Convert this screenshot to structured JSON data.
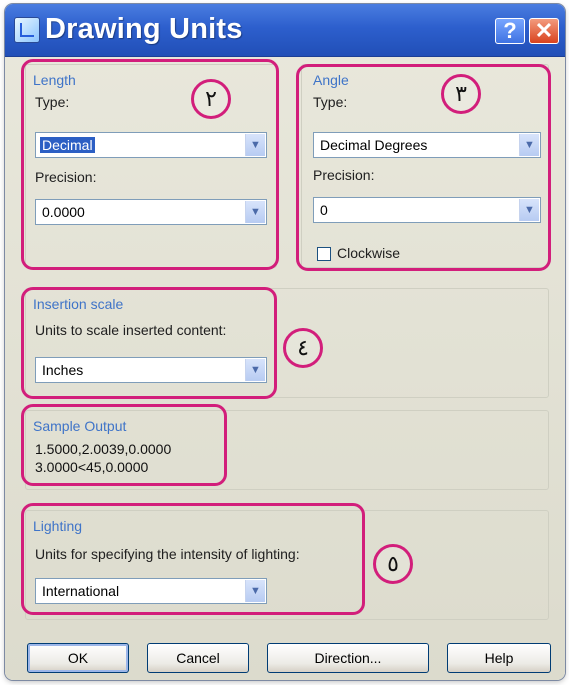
{
  "window": {
    "title": "Drawing Units",
    "help_glyph": "?",
    "close_glyph": "✕"
  },
  "length": {
    "legend": "Length",
    "type_label": "Type:",
    "type_value": "Decimal",
    "precision_label": "Precision:",
    "precision_value": "0.0000",
    "marker": "٢"
  },
  "angle": {
    "legend": "Angle",
    "type_label": "Type:",
    "type_value": "Decimal Degrees",
    "precision_label": "Precision:",
    "precision_value": "0",
    "clockwise_label": "Clockwise",
    "clockwise_checked": false,
    "marker": "٣"
  },
  "insertion": {
    "legend": "Insertion scale",
    "units_label": "Units to scale inserted content:",
    "units_value": "Inches",
    "marker": "٤"
  },
  "sample": {
    "legend": "Sample Output",
    "line1": "1.5000,2.0039,0.0000",
    "line2": "3.0000<45,0.0000"
  },
  "lighting": {
    "legend": "Lighting",
    "units_label": "Units for specifying the intensity of lighting:",
    "units_value": "International",
    "marker": "٥"
  },
  "buttons": {
    "ok": "OK",
    "cancel": "Cancel",
    "direction": "Direction...",
    "help": "Help"
  },
  "icons": {
    "dropdown": "chevron-down-icon",
    "app": "drawing-units-app-icon"
  },
  "colors": {
    "title_bar": "#2d5fcd",
    "annotation": "#d21e7b",
    "group_legend": "#3f74c8"
  }
}
